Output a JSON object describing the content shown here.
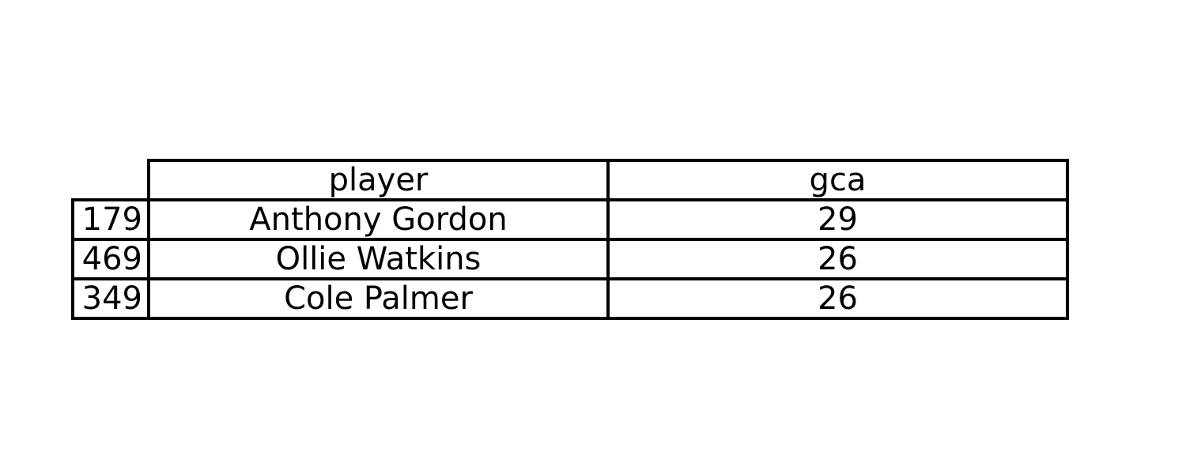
{
  "chart_data": {
    "type": "table",
    "columns": [
      "player",
      "gca"
    ],
    "rows": [
      {
        "index": "179",
        "player": "Anthony Gordon",
        "gca": 29
      },
      {
        "index": "469",
        "player": "Ollie Watkins",
        "gca": 26
      },
      {
        "index": "349",
        "player": "Cole Palmer",
        "gca": 26
      }
    ]
  }
}
